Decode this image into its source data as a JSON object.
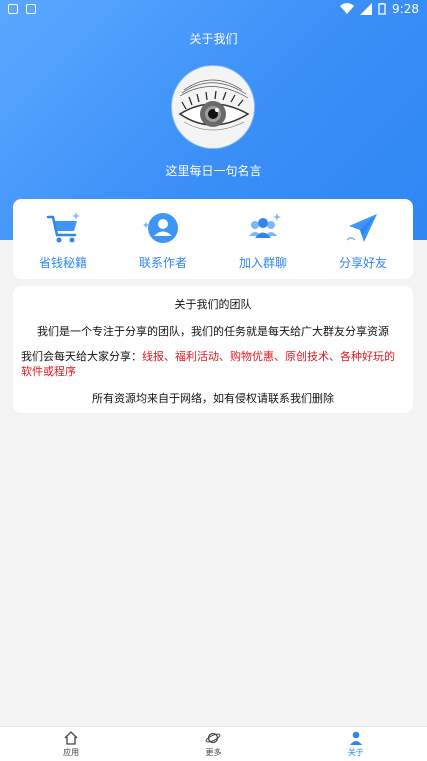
{
  "status_bar": {
    "time": "9:28"
  },
  "header": {
    "title": "关于我们",
    "quote": "这里每日一句名言"
  },
  "menu": {
    "items": [
      {
        "label": "省钱秘籍",
        "icon": "shopping-cart-icon"
      },
      {
        "label": "联系作者",
        "icon": "contact-user-icon"
      },
      {
        "label": "加入群聊",
        "icon": "group-chat-icon"
      },
      {
        "label": "分享好友",
        "icon": "paper-plane-icon"
      }
    ]
  },
  "about": {
    "heading": "关于我们的团队",
    "mission": "我们是一个专注于分享的团队，我们的任务就是每天给广大群友分享资源",
    "share_prefix": "我们会每天给大家分享：",
    "share_items": "线报、福利活动、购物优惠、原创技术、各种好玩的软件或程序",
    "disclaimer": "所有资源均来自于网络，如有侵权请联系我们删除"
  },
  "tabbar": {
    "tabs": [
      {
        "label": "应用",
        "icon": "home-icon"
      },
      {
        "label": "更多",
        "icon": "planet-icon"
      },
      {
        "label": "关于",
        "icon": "profile-icon",
        "active": true
      }
    ]
  },
  "colors": {
    "accent": "#2f86f3",
    "highlight": "#e0161e"
  }
}
